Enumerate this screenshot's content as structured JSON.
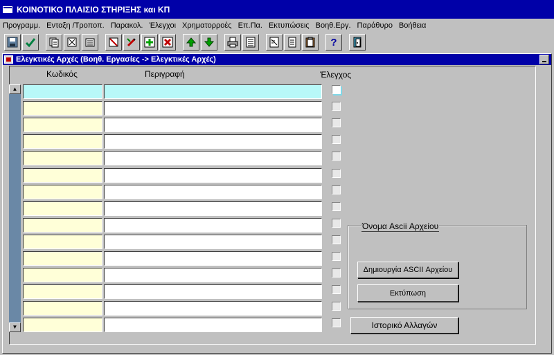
{
  "window": {
    "title": "ΚΟΙΝΟΤΙΚΟ ΠΛΑΙΣΙΟ ΣΤΗΡΙΞΗΣ και ΚΠ"
  },
  "menu": [
    "Προγραμμ.",
    "Ενταξη /Τροποπ.",
    "Παρακολ.",
    "Έλεγχοι",
    "Χρηματορροές",
    "Επ.Πα.",
    "Εκτυπώσεις",
    "Βοηθ.Εργ.",
    "Παράθυρο",
    "Βοήθεια"
  ],
  "toolbar": {
    "icons": [
      "save-icon",
      "accept-icon",
      "copy-record-icon",
      "clear-record-icon",
      "duplicate-icon",
      "query-icon",
      "edit-icon",
      "insert-record-icon",
      "delete-record-icon",
      "previous-record-icon",
      "next-record-icon",
      "print-icon",
      "list-values-icon",
      "notepad-icon",
      "document-icon",
      "clipboard-icon",
      "help-icon",
      "exit-icon"
    ],
    "help_glyph": "?"
  },
  "form": {
    "title": "Ελεγκτικές Αρχές (Βοηθ. Εργασίες -> Ελεγκτικές Αρχές)",
    "columns": {
      "code": "Κωδικός",
      "description": "Περιγραφή",
      "control": "Έλεγχος"
    },
    "rows": [
      {
        "code": "",
        "description": "",
        "checked": false
      },
      {
        "code": "",
        "description": "",
        "checked": false
      },
      {
        "code": "",
        "description": "",
        "checked": false
      },
      {
        "code": "",
        "description": "",
        "checked": false
      },
      {
        "code": "",
        "description": "",
        "checked": false
      },
      {
        "code": "",
        "description": "",
        "checked": false
      },
      {
        "code": "",
        "description": "",
        "checked": false
      },
      {
        "code": "",
        "description": "",
        "checked": false
      },
      {
        "code": "",
        "description": "",
        "checked": false
      },
      {
        "code": "",
        "description": "",
        "checked": false
      },
      {
        "code": "",
        "description": "",
        "checked": false
      },
      {
        "code": "",
        "description": "",
        "checked": false
      },
      {
        "code": "",
        "description": "",
        "checked": false
      },
      {
        "code": "",
        "description": "",
        "checked": false
      },
      {
        "code": "",
        "description": "",
        "checked": false
      }
    ],
    "ascii_group": {
      "label": "Όνομα Ascii Αρχείου",
      "create_button": "Δημιουργία  ASCII Αρχείου",
      "print_button": "Εκτύπωση"
    },
    "history_button": "Ιστορικό Αλλαγών"
  },
  "colors": {
    "title_bar": "#0000a8",
    "current_row": "#b8f8f8",
    "code_field": "#ffffd8",
    "scrollbar": "#6a88a6"
  }
}
